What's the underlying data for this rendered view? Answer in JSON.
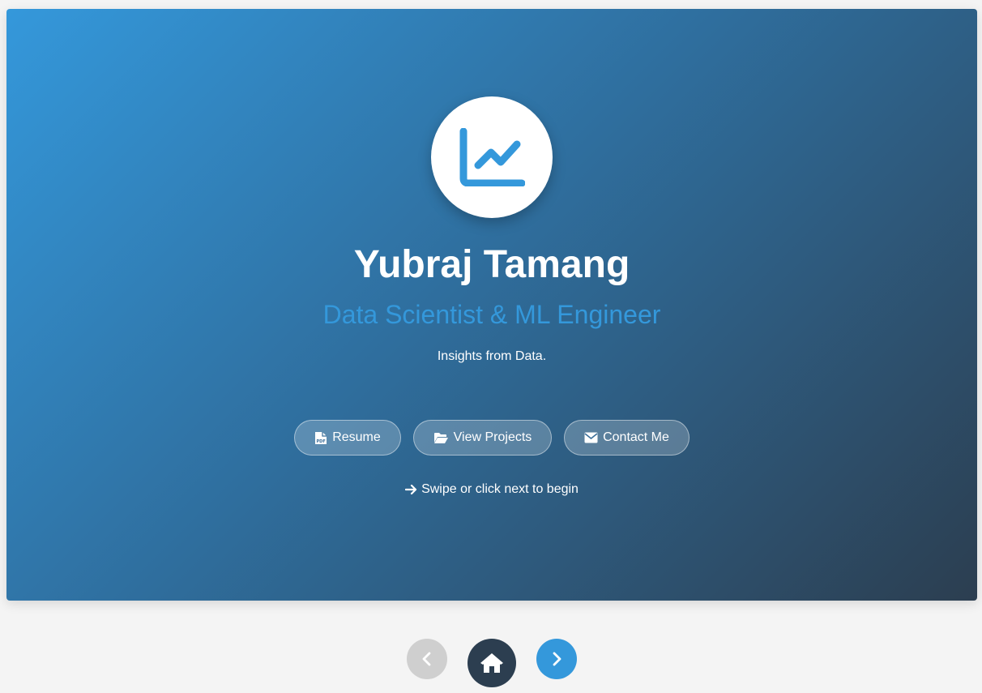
{
  "hero": {
    "logo_icon": "chart-line-icon",
    "name": "Yubraj Tamang",
    "role": "Data Scientist & ML Engineer",
    "tagline": "Insights from Data.",
    "buttons": [
      {
        "label": "Resume",
        "icon": "file-pdf-icon"
      },
      {
        "label": "View Projects",
        "icon": "folder-open-icon"
      },
      {
        "label": "Contact Me",
        "icon": "envelope-icon"
      }
    ],
    "hint": "Swipe or click next to begin",
    "hint_icon": "arrow-right-icon"
  },
  "nav": {
    "prev_icon": "chevron-left-icon",
    "home_icon": "home-icon",
    "next_icon": "chevron-right-icon"
  },
  "colors": {
    "accent": "#3498db",
    "dark": "#2c3e50",
    "background": "#f4f4f4"
  }
}
